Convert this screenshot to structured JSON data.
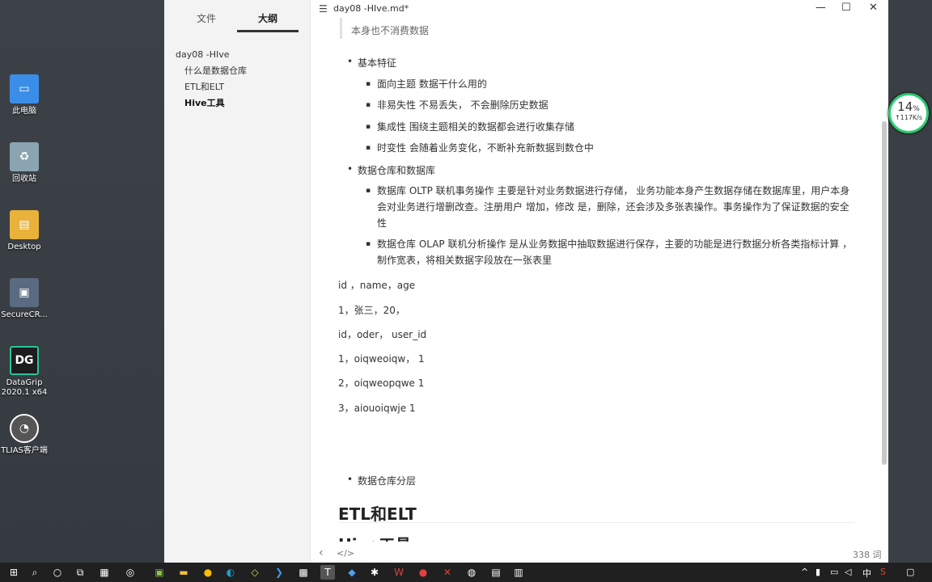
{
  "desktop": {
    "icons": [
      {
        "label": "此电脑",
        "icon": "computer-icon",
        "color": "#3b8ee8"
      },
      {
        "label": "回收站",
        "icon": "recycle-bin-icon",
        "color": "#8aa"
      },
      {
        "label": "Desktop",
        "icon": "folder-icon",
        "color": "#e8b23b"
      },
      {
        "label": "SecureCR...",
        "icon": "securecrt-icon",
        "color": "#5a6a80"
      },
      {
        "label": "DataGrip\n2020.1 x64",
        "icon": "datagrip-icon",
        "color": "#2bc39a"
      },
      {
        "label": "TLIAS客户端",
        "icon": "tlias-icon",
        "color": "#666"
      }
    ]
  },
  "sidebar": {
    "tabs": [
      {
        "label": "文件"
      },
      {
        "label": "大纲"
      }
    ],
    "outline": [
      {
        "label": "day08 -HIve"
      },
      {
        "label": "什么是数据仓库"
      },
      {
        "label": "ETL和ELT"
      },
      {
        "label": "Hive工具"
      }
    ]
  },
  "titlebar": {
    "title": "day08 -HIve.md*",
    "minimize": "—",
    "maximize": "☐",
    "close": "✕"
  },
  "editor": {
    "quote": "本身也不消费数据",
    "b_features": "基本特征",
    "features": [
      "面向主题   数据干什么用的",
      "非易失性   不易丢失，  不会删除历史数据",
      "集成性  围绕主题相关的数据都会进行收集存储",
      "时变性  会随着业务变化，不断补充新数据到数仓中"
    ],
    "b_compare": "数据仓库和数据库",
    "compare": [
      "数据库    OLTP 联机事务操作 主要是针对业务数据进行存储，  业务功能本身产生数据存储在数据库里，用户本身会对业务进行增删改查。注册用户 增加，修改  是，删除，还会涉及多张表操作。事务操作为了保证数据的安全性",
      " 数据仓库    OLAP  联机分析操作  是从业务数据中抽取数据进行保存，主要的功能是进行数据分析各类指标计算  ，  制作宽表，将相关数据字段放在一张表里"
    ],
    "paras": [
      "id ，name，age",
      "1，张三，20，",
      "id，oder，        user_id",
      "1，oiqweoiqw，  1",
      "2，oiqweopqwe  1",
      "3，aiouoiqwje     1"
    ],
    "b_layers": "数据仓库分层",
    "h_etl": "ETL和ELT",
    "h_hive": "Hive工具"
  },
  "statusbar": {
    "back": "‹",
    "code": "</>",
    "words": "338 词"
  },
  "netwidget": {
    "percent": "14",
    "percent_unit": "%",
    "speed": "↑117K/s"
  },
  "taskbar": {
    "ime": "中"
  }
}
